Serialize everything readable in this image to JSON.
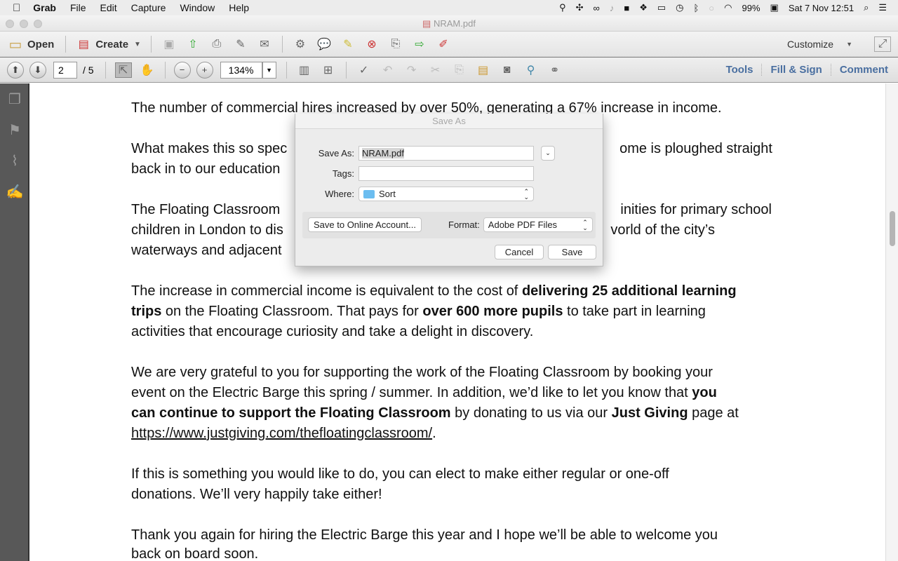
{
  "menubar": {
    "app": "Grab",
    "items": [
      "File",
      "Edit",
      "Capture",
      "Window",
      "Help"
    ],
    "battery": "99%",
    "clock": "Sat 7 Nov  12:51",
    "status_icons": [
      "broom-icon",
      "pinwheel-icon",
      "infinity-icon",
      "bell-icon",
      "folder-icon",
      "dropbox-icon",
      "airplay-icon",
      "time-machine-icon",
      "bluetooth-icon",
      "chat-icon",
      "wifi-icon",
      "battery-icon",
      "spotlight-icon",
      "notification-list-icon"
    ]
  },
  "window": {
    "title": "NRAM.pdf"
  },
  "toolbar": {
    "open": "Open",
    "create": "Create",
    "customize": "Customize"
  },
  "nav": {
    "page": "2",
    "total": "/ 5",
    "zoom": "134%",
    "panes": [
      "Tools",
      "Fill & Sign",
      "Comment"
    ]
  },
  "document": {
    "lines": [
      {
        "l": "The number of commercial hires increased by over 50%, generating a 67% increase in income."
      },
      {
        "l": "What makes this so spec",
        "r": "ome is ploughed straight"
      },
      {
        "l": "back in to our education"
      },
      {
        "l": "The Floating Classroom",
        "r": "inities for primary school"
      },
      {
        "l": "children in London to dis",
        "r": "vorld of the city’s"
      },
      {
        "l": "waterways and adjacent"
      },
      {
        "l": "The increase in commercial income is equivalent to the cost of ",
        "b": "delivering 25 additional learning"
      },
      {
        "b": "trips",
        "l": " on the Floating Classroom. That pays for ",
        "b2": "over 600 more pupils",
        "l2": " to take part in learning"
      },
      {
        "l": "activities that encourage curiosity and take a delight in discovery."
      },
      {
        "l": "We are very grateful to you for supporting the work of the Floating Classroom by booking your"
      },
      {
        "l": "event on the Electric Barge this spring / summer. In addition, we’d like to let you know that ",
        "b": "you"
      },
      {
        "b": "can continue to support the Floating Classroom",
        "l": " by donating to us via our ",
        "b2": "Just Giving",
        "l2": " page at"
      },
      {
        "u": "https://www.justgiving.com/thefloatingclassroom/",
        "l": "."
      },
      {
        "l": "If this is something you would like to do, you can elect to make either regular or one-off"
      },
      {
        "l": "donations. We’ll very happily take either!"
      },
      {
        "l": "Thank you again for hiring the Electric Barge this year and I hope we’ll be able to welcome you"
      },
      {
        "l": "back on board soon."
      }
    ]
  },
  "dialog": {
    "title": "Save As",
    "save_as_label": "Save As:",
    "filename": "NRAM.pdf",
    "tags_label": "Tags:",
    "tags": "",
    "where_label": "Where:",
    "where": "Sort",
    "online": "Save to Online Account...",
    "format_label": "Format:",
    "format": "Adobe PDF Files",
    "cancel": "Cancel",
    "save": "Save"
  }
}
